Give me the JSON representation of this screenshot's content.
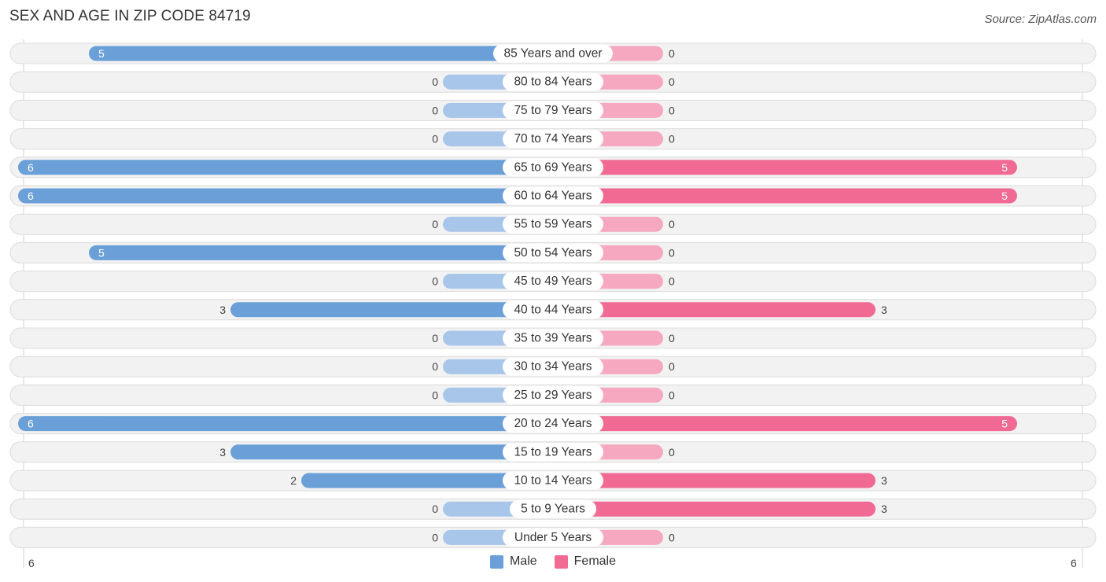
{
  "header": {
    "title": "SEX AND AGE IN ZIP CODE 84719",
    "source": "Source: ZipAtlas.com"
  },
  "colors": {
    "male": "#6a9fd8",
    "male_light": "#a8c6ea",
    "female": "#f06a94",
    "female_light": "#f5a8c0",
    "row_bg": "#f2f2f2"
  },
  "chart_data": {
    "type": "bar",
    "orientation": "horizontal-diverging",
    "title": "SEX AND AGE IN ZIP CODE 84719",
    "categories": [
      "85 Years and over",
      "80 to 84 Years",
      "75 to 79 Years",
      "70 to 74 Years",
      "65 to 69 Years",
      "60 to 64 Years",
      "55 to 59 Years",
      "50 to 54 Years",
      "45 to 49 Years",
      "40 to 44 Years",
      "35 to 39 Years",
      "30 to 34 Years",
      "25 to 29 Years",
      "20 to 24 Years",
      "15 to 19 Years",
      "10 to 14 Years",
      "5 to 9 Years",
      "Under 5 Years"
    ],
    "series": [
      {
        "name": "Male",
        "values": [
          5,
          0,
          0,
          0,
          6,
          6,
          0,
          5,
          0,
          3,
          0,
          0,
          0,
          6,
          3,
          2,
          0,
          0
        ]
      },
      {
        "name": "Female",
        "values": [
          0,
          0,
          0,
          0,
          5,
          5,
          0,
          0,
          0,
          3,
          0,
          0,
          0,
          5,
          0,
          3,
          3,
          0
        ]
      }
    ],
    "axis": {
      "left_max_label": "6",
      "right_max_label": "6",
      "range": [
        0,
        6
      ]
    },
    "legend": {
      "position": "bottom-center",
      "entries": [
        "Male",
        "Female"
      ]
    }
  }
}
